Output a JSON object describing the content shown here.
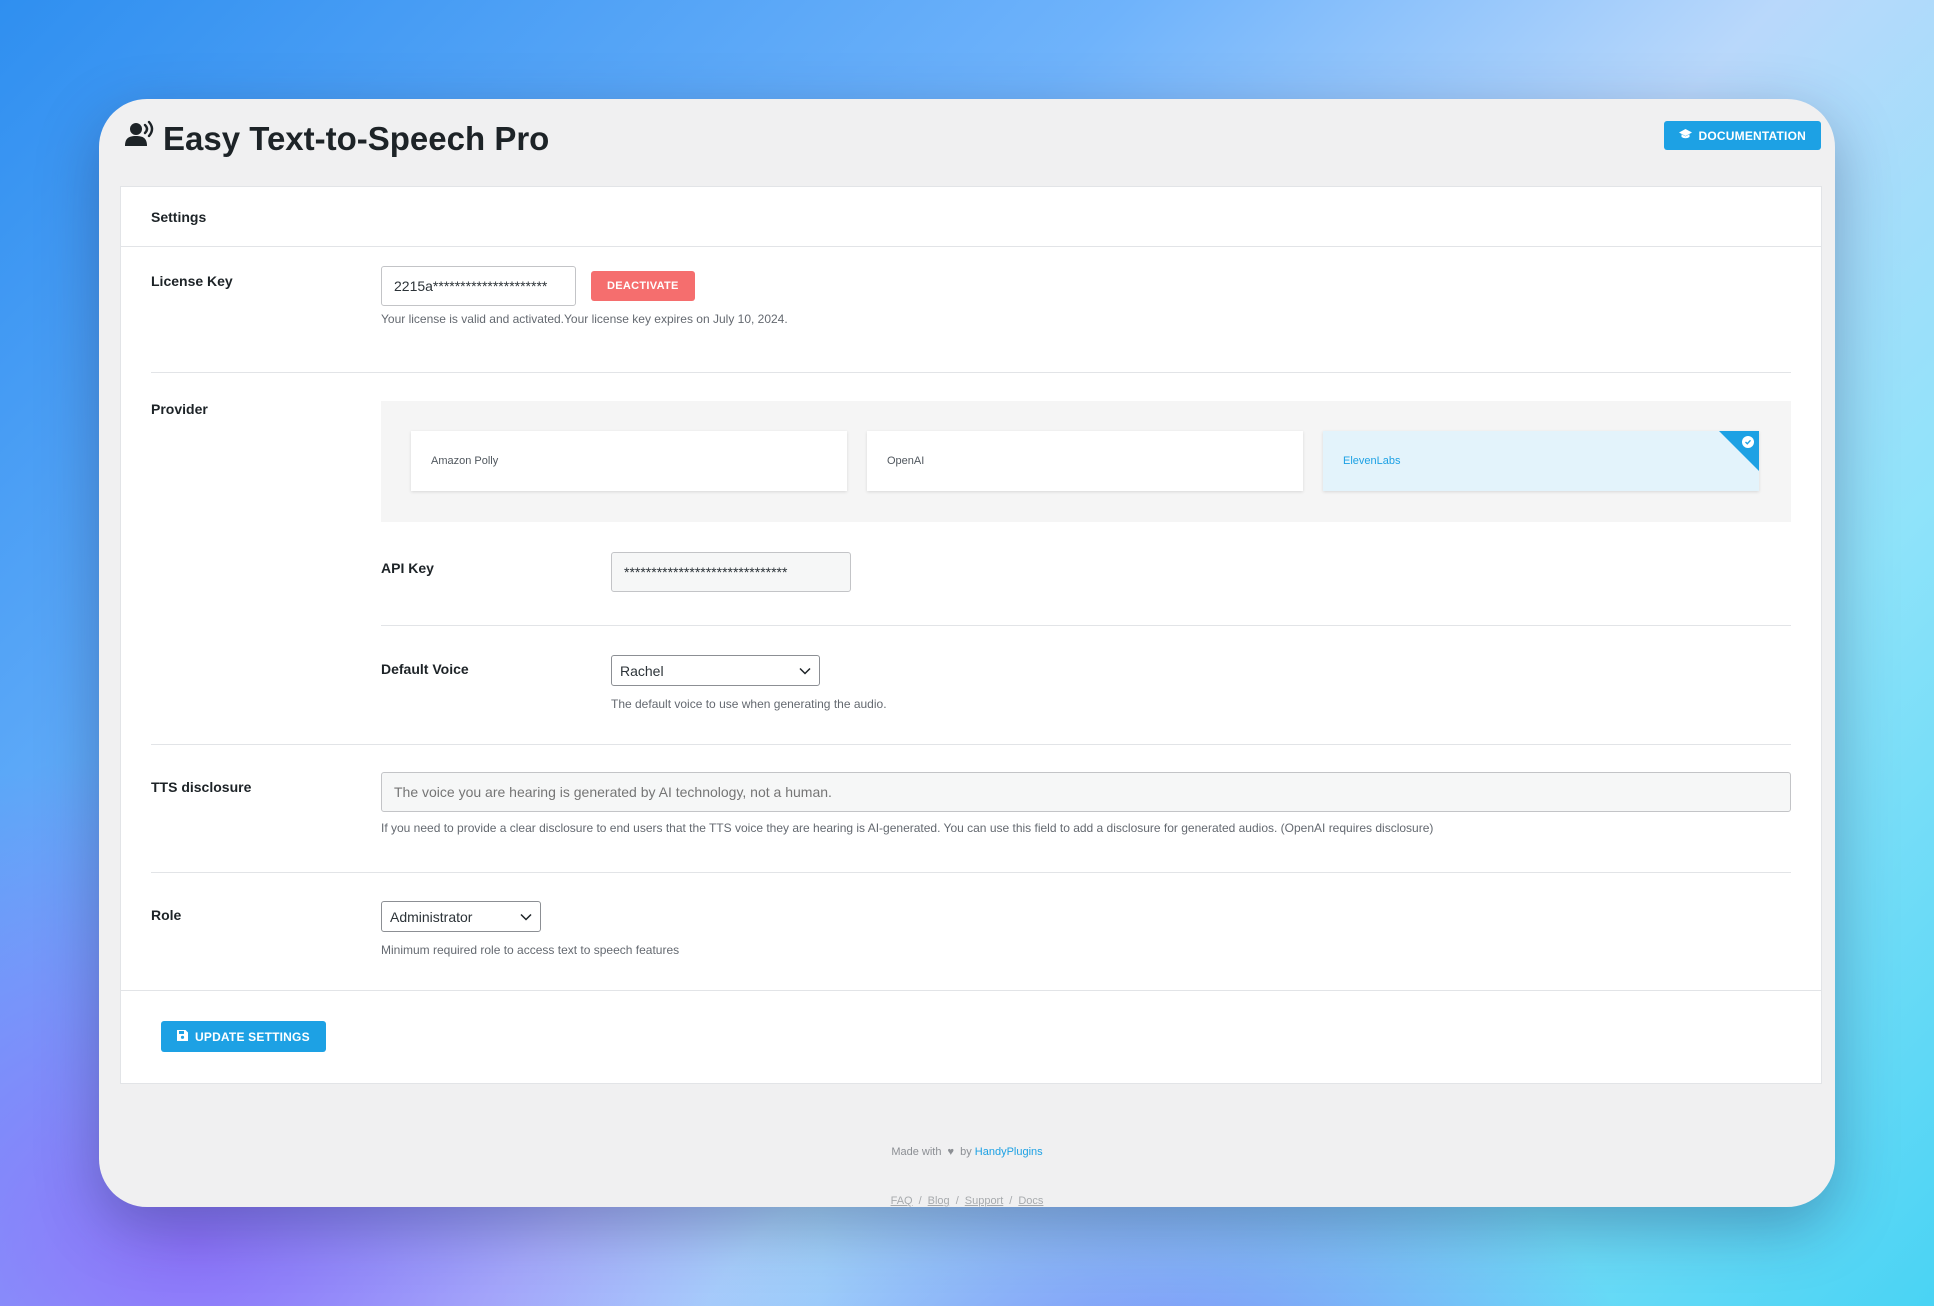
{
  "app": {
    "title": "Easy Text-to-Speech Pro",
    "documentation_label": "DOCUMENTATION"
  },
  "card": {
    "header": "Settings"
  },
  "license": {
    "label": "License Key",
    "value": "2215a*********************",
    "deactivate_label": "DEACTIVATE",
    "help": "Your license is valid and activated.Your license key expires on July 10, 2024."
  },
  "provider": {
    "label": "Provider",
    "options": [
      "Amazon Polly",
      "OpenAI",
      "ElevenLabs"
    ],
    "selected": "ElevenLabs"
  },
  "api_key": {
    "label": "API Key",
    "value": "******************************"
  },
  "default_voice": {
    "label": "Default Voice",
    "value": "Rachel",
    "help": "The default voice to use when generating the audio."
  },
  "tts_disclosure": {
    "label": "TTS disclosure",
    "placeholder": "The voice you are hearing is generated by AI technology, not a human.",
    "help": "If you need to provide a clear disclosure to end users that the TTS voice they are hearing is AI-generated. You can use this field to add a disclosure for generated audios. (OpenAI requires disclosure)"
  },
  "role": {
    "label": "Role",
    "value": "Administrator",
    "help": "Minimum required role to access text to speech features"
  },
  "update_label": "UPDATE SETTINGS",
  "footer": {
    "made_with": "Made with",
    "by": "by",
    "author": "HandyPlugins",
    "links": [
      "FAQ",
      "Blog",
      "Support",
      "Docs"
    ]
  },
  "colors": {
    "accent": "#1da1e4",
    "danger": "#f56e6e",
    "active_card_bg": "#e3f3fb"
  },
  "icons": {
    "title": "speaking-user-icon",
    "documentation": "graduation-cap-icon",
    "update": "save-icon",
    "footer": "heart-icon",
    "selected": "check-circle-icon"
  }
}
